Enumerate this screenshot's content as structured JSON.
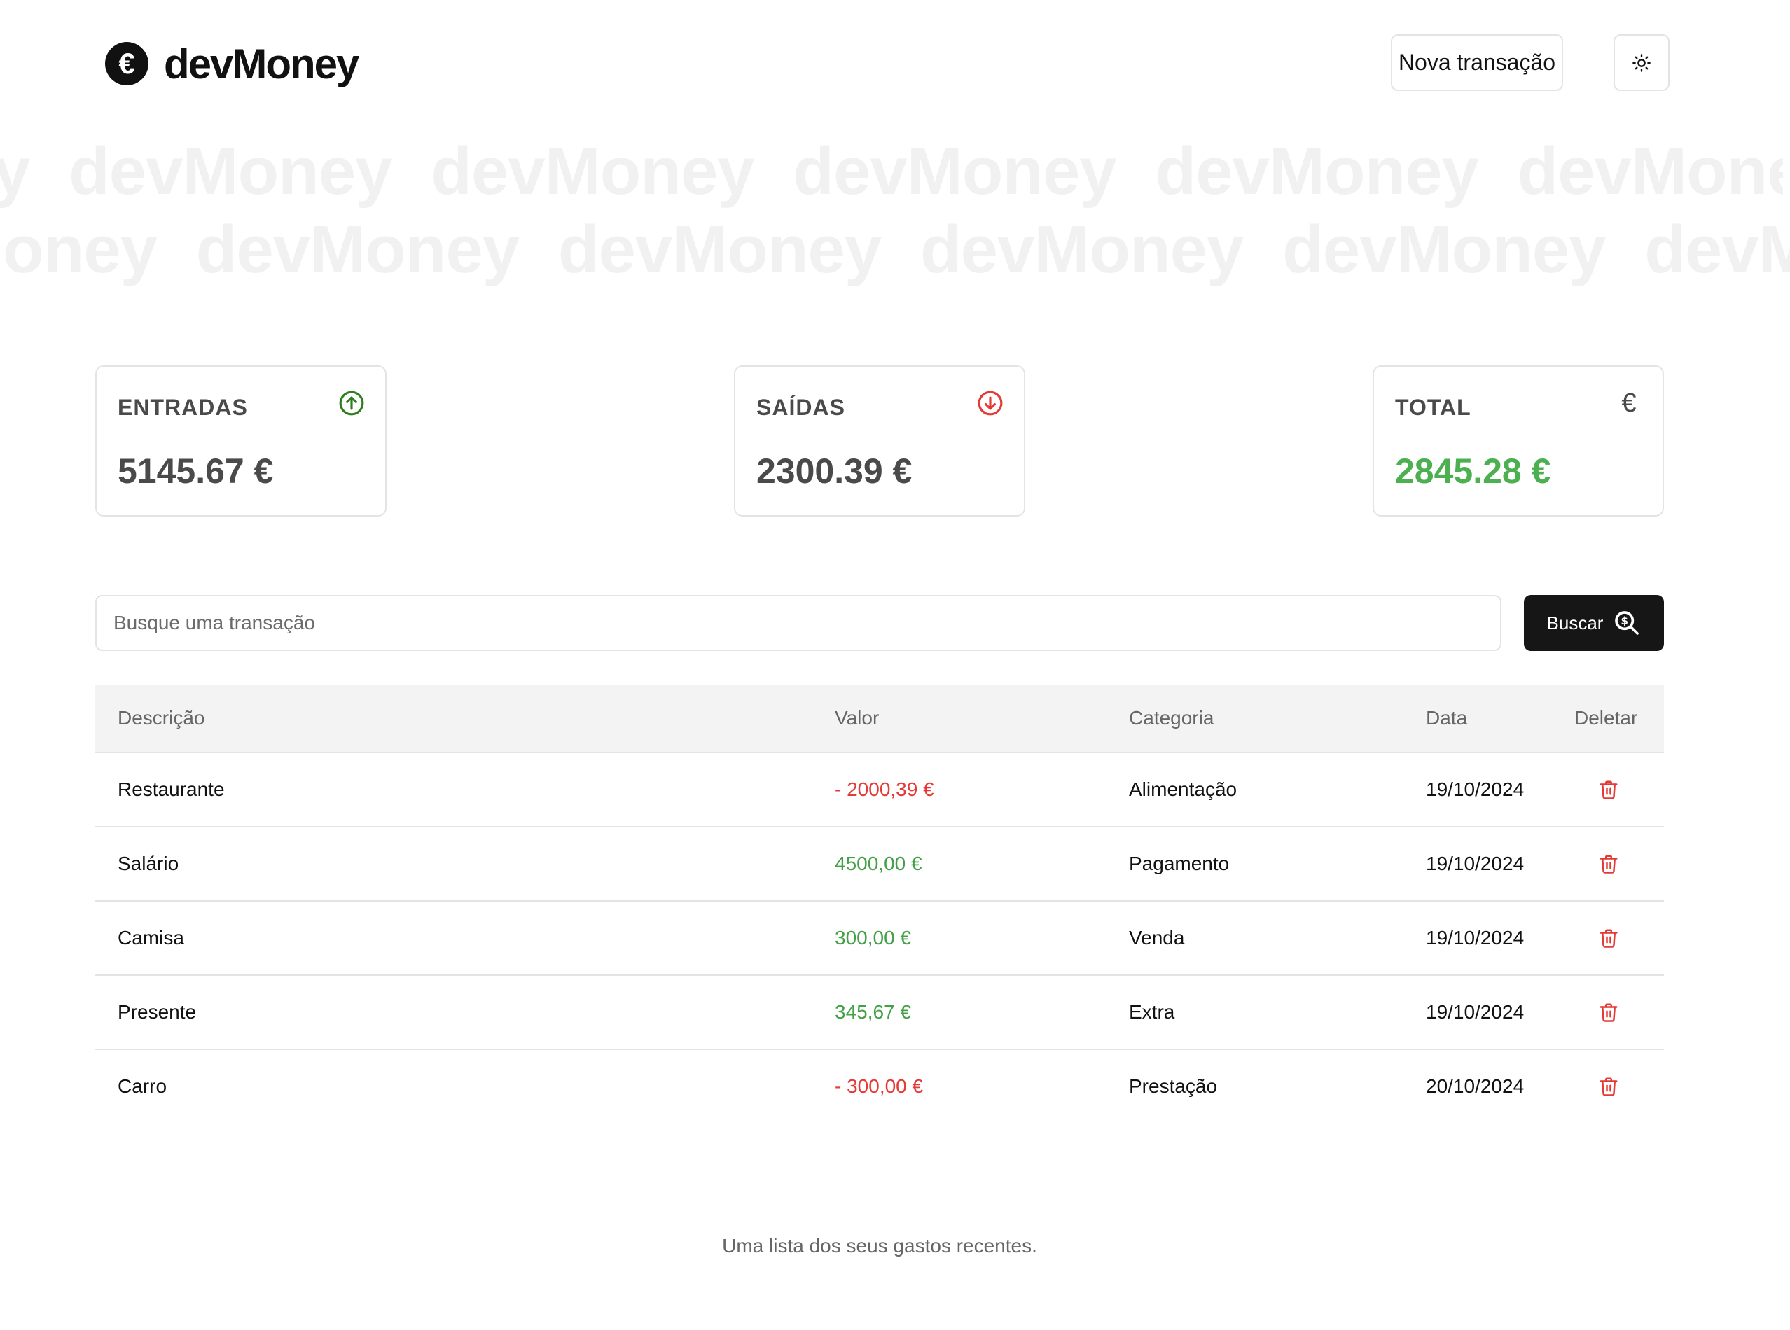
{
  "header": {
    "logo_glyph": "€",
    "logo_text": "devMoney",
    "new_transaction_label": "Nova transação",
    "theme_icon": "sun-icon"
  },
  "watermark": {
    "line1": "y devMoney devMoney devMoney devMoney devMoney devMoney",
    "line2": "oney devMoney devMoney devMoney devMoney devMoney"
  },
  "summary": {
    "income": {
      "label": "ENTRADAS",
      "value": "5145.67 €",
      "icon": "arrow-up-circle-icon",
      "color": "#2e7d1e"
    },
    "outcome": {
      "label": "SAÍDAS",
      "value": "2300.39 €",
      "icon": "arrow-down-circle-icon",
      "color": "#e53935"
    },
    "total": {
      "label": "TOTAL",
      "value": "2845.28 €",
      "icon": "€",
      "color": "#4caf50"
    }
  },
  "search": {
    "placeholder": "Busque uma transação",
    "button_label": "Buscar"
  },
  "table": {
    "headers": {
      "description": "Descrição",
      "value": "Valor",
      "category": "Categoria",
      "date": "Data",
      "delete": "Deletar"
    },
    "rows": [
      {
        "description": "Restaurante",
        "value": "- 2000,39 €",
        "type": "negative",
        "category": "Alimentação",
        "date": "19/10/2024"
      },
      {
        "description": "Salário",
        "value": "4500,00 €",
        "type": "positive",
        "category": "Pagamento",
        "date": "19/10/2024"
      },
      {
        "description": "Camisa",
        "value": "300,00 €",
        "type": "positive",
        "category": "Venda",
        "date": "19/10/2024"
      },
      {
        "description": "Presente",
        "value": "345,67 €",
        "type": "positive",
        "category": "Extra",
        "date": "19/10/2024"
      },
      {
        "description": "Carro",
        "value": "- 300,00 €",
        "type": "negative",
        "category": "Prestação",
        "date": "20/10/2024"
      }
    ],
    "caption": "Uma lista dos seus gastos recentes."
  },
  "colors": {
    "negative": "#e53935",
    "positive": "#43a047",
    "dark": "#161616"
  }
}
